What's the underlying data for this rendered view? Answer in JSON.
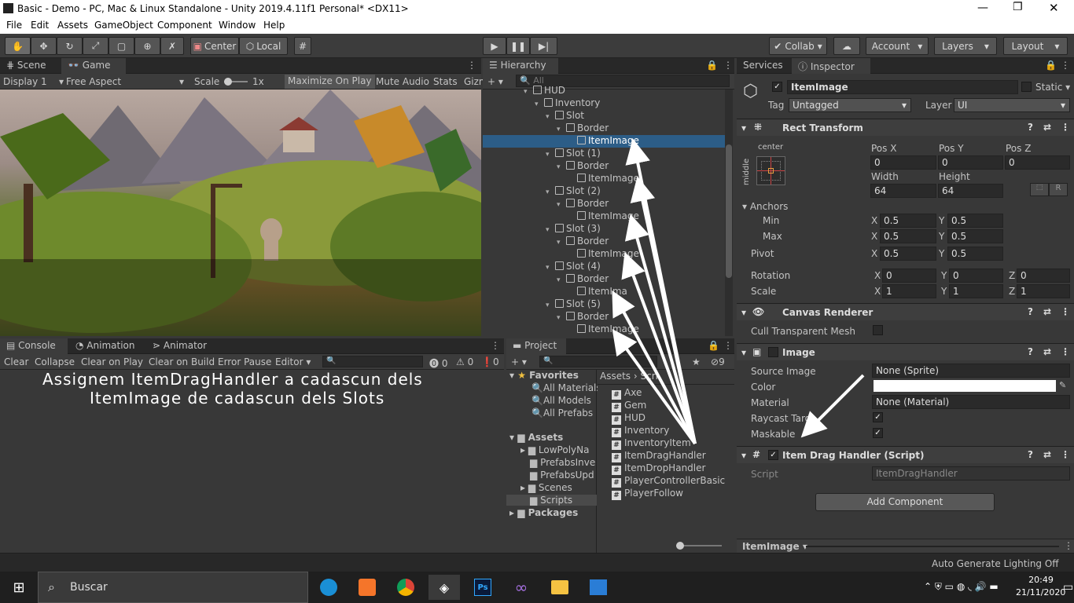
{
  "window": {
    "title": "Basic - Demo - PC, Mac & Linux Standalone - Unity 2019.4.11f1 Personal* <DX11>"
  },
  "menu": [
    "File",
    "Edit",
    "Assets",
    "GameObject",
    "Component",
    "Window",
    "Help"
  ],
  "toolbar": {
    "center": "Center",
    "local": "Local",
    "collab": "Collab",
    "account": "Account",
    "layers": "Layers",
    "layout": "Layout"
  },
  "scene_panel": {
    "tab_scene": "Scene",
    "tab_game": "Game",
    "display": "Display 1",
    "aspect": "Free Aspect",
    "scale_label": "Scale",
    "scale_value": "1x",
    "maximize": "Maximize On Play",
    "mute": "Mute Audio",
    "stats": "Stats",
    "gizmos": "Gizm"
  },
  "hierarchy": {
    "tab": "Hierarchy",
    "search_placeholder": "All",
    "rows": [
      {
        "label": "HUD"
      },
      {
        "label": "Inventory"
      },
      {
        "label": "Slot"
      },
      {
        "label": "Border"
      },
      {
        "label": "ItemImage"
      },
      {
        "label": "Slot (1)"
      },
      {
        "label": "Border"
      },
      {
        "label": "ItemImage"
      },
      {
        "label": "Slot (2)"
      },
      {
        "label": "Border"
      },
      {
        "label": "ItemImage"
      },
      {
        "label": "Slot (3)"
      },
      {
        "label": "Border"
      },
      {
        "label": "ItemImage"
      },
      {
        "label": "Slot (4)"
      },
      {
        "label": "Border"
      },
      {
        "label": "ItemIma"
      },
      {
        "label": "Slot (5)"
      },
      {
        "label": "Border"
      },
      {
        "label": "ItemImage"
      }
    ]
  },
  "console": {
    "tab_console": "Console",
    "tab_animation": "Animation",
    "tab_animator": "Animator",
    "clear": "Clear",
    "collapse": "Collapse",
    "clear_on_play": "Clear on Play",
    "clear_on_build": "Clear on Build",
    "error_pause": "Error Pause",
    "editor": "Editor",
    "count_a": "0",
    "count_b": "0",
    "count_c": "0",
    "message_line1": "Assignem ItemDragHandler a cadascun dels",
    "message_line2": "ItemImage de cadascun dels Slots"
  },
  "project": {
    "tab": "Project",
    "count": "9",
    "favorites": "Favorites",
    "all_materials": "All Materials",
    "all_models": "All Models",
    "all_prefabs": "All Prefabs",
    "assets": "Assets",
    "low_poly": "LowPolyNa",
    "prefabs_inv": "PrefabsInve",
    "prefabs_upd": "PrefabsUpd",
    "scenes": "Scenes",
    "scripts": "Scripts",
    "packages": "Packages",
    "breadcrumb_root": "Assets",
    "breadcrumb_leaf": "Scri",
    "files": [
      "Axe",
      "Gem",
      "HUD",
      "Inventory",
      "InventoryItem",
      "ItemDragHandler",
      "ItemDropHandler",
      "PlayerControllerBasic",
      "PlayerFollow"
    ]
  },
  "inspector": {
    "tab_services": "Services",
    "tab_inspector": "Inspector",
    "object_name": "ItemImage",
    "static": "Static",
    "tag_label": "Tag",
    "tag_value": "Untagged",
    "layer_label": "Layer",
    "layer_value": "UI",
    "rect_transform": "Rect Transform",
    "anchor_h": "center",
    "anchor_v": "middle",
    "pos_x_label": "Pos X",
    "pos_y_label": "Pos Y",
    "pos_z_label": "Pos Z",
    "pos_x": "0",
    "pos_y": "0",
    "pos_z": "0",
    "width_label": "Width",
    "height_label": "Height",
    "width": "64",
    "height": "64",
    "r_btn": "R",
    "anchors": "Anchors",
    "min": "Min",
    "max": "Max",
    "pivot": "Pivot",
    "x": "X",
    "y": "Y",
    "z": "Z",
    "min_x": "0.5",
    "min_y": "0.5",
    "max_x": "0.5",
    "max_y": "0.5",
    "pivot_x": "0.5",
    "pivot_y": "0.5",
    "rotation": "Rotation",
    "rot_x": "0",
    "rot_y": "0",
    "rot_z": "0",
    "scale": "Scale",
    "scale_x": "1",
    "scale_y": "1",
    "scale_z": "1",
    "canvas_renderer": "Canvas Renderer",
    "cull": "Cull Transparent Mesh",
    "image": "Image",
    "source_image": "Source Image",
    "source_image_value": "None (Sprite)",
    "color": "Color",
    "material": "Material",
    "material_value": "None (Material)",
    "raycast": "Raycast Targ",
    "maskable": "Maskable",
    "drag_handler": "Item Drag Handler (Script)",
    "script_label": "Script",
    "script_value": "ItemDragHandler",
    "add_component": "Add Component",
    "footer": "ItemImage"
  },
  "status": {
    "lighting": "Auto Generate Lighting Off"
  },
  "taskbar": {
    "search": "Buscar",
    "time": "20:49",
    "date": "21/11/2020"
  }
}
